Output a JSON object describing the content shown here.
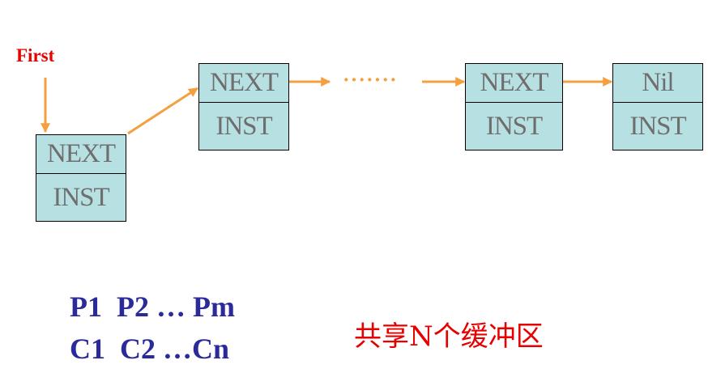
{
  "first_label": "First",
  "ellipsis": "·······",
  "nodes": [
    {
      "next": "NEXT",
      "inst": "INST"
    },
    {
      "next": "NEXT",
      "inst": "INST"
    },
    {
      "next": "NEXT",
      "inst": "INST"
    },
    {
      "next": "Nil",
      "inst": "INST"
    }
  ],
  "producers": "P1  P2 … Pm",
  "consumers": "C1  C2 …Cn",
  "buffer_label": "共享N个缓冲区",
  "colors": {
    "node_fill": "#b7e0e3",
    "arrow": "#f4a040",
    "label_red": "#e60000",
    "text_blue": "#2a2a9a",
    "cell_text": "#6e6e6e"
  }
}
